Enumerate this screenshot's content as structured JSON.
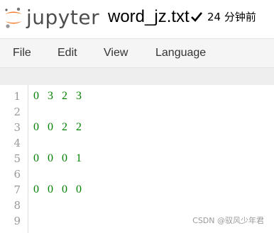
{
  "header": {
    "logo_text": "jupyter",
    "filename": "word_jz.txt",
    "saved_time": "24 分钟前"
  },
  "menu": {
    "items": [
      {
        "label": "File"
      },
      {
        "label": "Edit"
      },
      {
        "label": "View"
      },
      {
        "label": "Language"
      }
    ]
  },
  "editor": {
    "line_numbers": [
      "1",
      "2",
      "3",
      "4",
      "5",
      "6",
      "7",
      "8",
      "9"
    ],
    "lines": [
      "0 3 2 3",
      "",
      "0 0 2 2",
      "",
      "0 0 0 1",
      "",
      "0 0 0 0",
      "",
      ""
    ]
  },
  "watermark": "CSDN @驭风少年君",
  "colors": {
    "logo_orange": "#F37726",
    "code_green": "#008000",
    "line_number_gray": "#999999"
  }
}
